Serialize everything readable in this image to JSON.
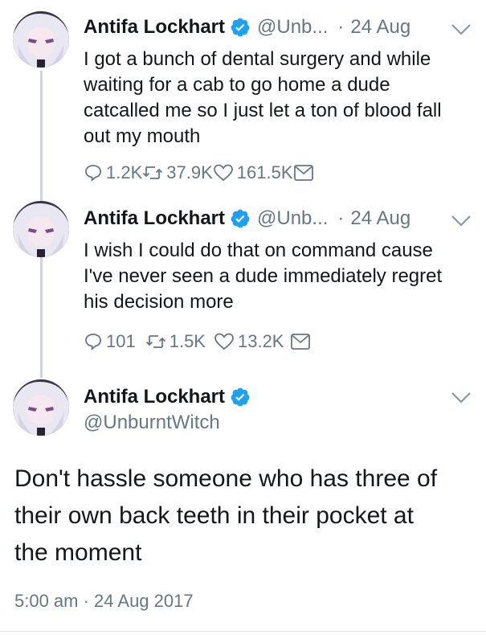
{
  "colors": {
    "verified": "#1da1f2",
    "secondary_text": "#657786",
    "thread_line": "#ccd6dd"
  },
  "tweets": [
    {
      "name": "Antifa Lockhart",
      "handle": "@Unb...",
      "date": "24 Aug",
      "text": "I got a bunch of dental surgery and while\nwaiting for a cab to go home a dude\ncatcalled me so I just let a ton of blood fall\nout my mouth",
      "replies": "1.2K",
      "retweets": "37.9K",
      "likes": "161.5K"
    },
    {
      "name": "Antifa Lockhart",
      "handle": "@Unb...",
      "date": "24 Aug",
      "text": "I wish I could do that on command cause\nI've never seen a dude immediately regret\nhis decision more",
      "replies": "101",
      "retweets": "1.5K",
      "likes": "13.2K"
    }
  ],
  "main_tweet": {
    "name": "Antifa Lockhart",
    "handle": "@UnburntWitch",
    "text": "Don't hassle someone who has three of\ntheir own back teeth in their pocket at\nthe moment",
    "timestamp": "5:00 am · 24 Aug 2017"
  },
  "icons": [
    "reply-icon",
    "retweet-icon",
    "like-icon",
    "dm-icon",
    "verified-icon",
    "chevron-down-icon"
  ]
}
